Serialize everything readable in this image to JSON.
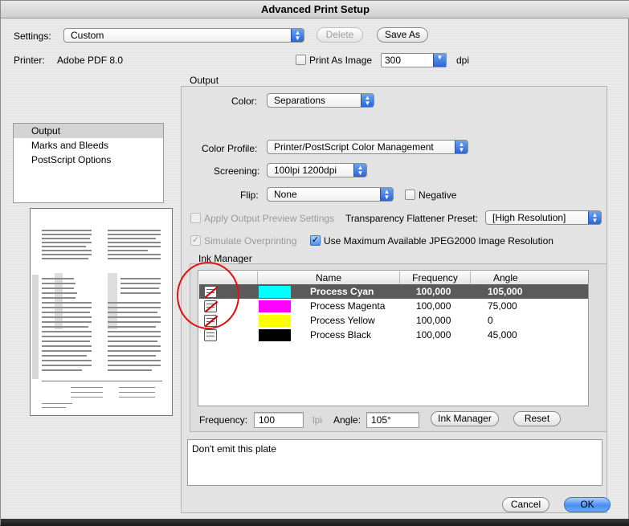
{
  "window": {
    "title": "Advanced Print Setup"
  },
  "settings": {
    "label": "Settings:",
    "value": "Custom",
    "delete_label": "Delete",
    "save_as_label": "Save As"
  },
  "printer": {
    "label": "Printer:",
    "value": "Adobe PDF 8.0",
    "print_as_image_label": "Print As Image",
    "print_as_image_checked": false,
    "dpi_value": "300",
    "dpi_unit": "dpi"
  },
  "sidebar": {
    "items": [
      {
        "label": "Output",
        "selected": true
      },
      {
        "label": "Marks and Bleeds",
        "selected": false
      },
      {
        "label": "PostScript Options",
        "selected": false
      }
    ]
  },
  "output": {
    "group_label": "Output",
    "color_label": "Color:",
    "color_value": "Separations",
    "color_profile_label": "Color Profile:",
    "color_profile_value": "Printer/PostScript Color Management",
    "screening_label": "Screening:",
    "screening_value": "100lpi 1200dpi",
    "flip_label": "Flip:",
    "flip_value": "None",
    "negative_label": "Negative",
    "negative_checked": false,
    "apply_preview_label": "Apply Output Preview Settings",
    "apply_preview_checked": false,
    "transparency_label": "Transparency Flattener Preset:",
    "transparency_value": "[High Resolution]",
    "simulate_overprint_label": "Simulate Overprinting",
    "simulate_overprint_checked": true,
    "jpeg2000_label": "Use Maximum Available JPEG2000 Image Resolution",
    "jpeg2000_checked": true
  },
  "ink_manager": {
    "group_label": "Ink Manager",
    "columns": [
      "Name",
      "Frequency",
      "Angle"
    ],
    "rows": [
      {
        "name": "Process Cyan",
        "frequency": "100,000",
        "angle": "105,000",
        "color": "#00ffff",
        "selected": true
      },
      {
        "name": "Process Magenta",
        "frequency": "100,000",
        "angle": "75,000",
        "color": "#ff00ff",
        "selected": false
      },
      {
        "name": "Process Yellow",
        "frequency": "100,000",
        "angle": "0",
        "color": "#ffff00",
        "selected": false
      },
      {
        "name": "Process Black",
        "frequency": "100,000",
        "angle": "45,000",
        "color": "#000000",
        "selected": false
      }
    ],
    "frequency_label": "Frequency:",
    "frequency_value": "100",
    "frequency_unit": "lpi",
    "angle_label": "Angle:",
    "angle_value": "105°",
    "ink_manager_button": "Ink Manager",
    "reset_button": "Reset"
  },
  "description": {
    "text": "Don't emit this plate"
  },
  "footer": {
    "cancel_label": "Cancel",
    "ok_label": "OK"
  },
  "colors": {
    "accent": "#2a64d6",
    "selected_row": "#5a5a5a",
    "annotation_circle": "#e01010"
  }
}
